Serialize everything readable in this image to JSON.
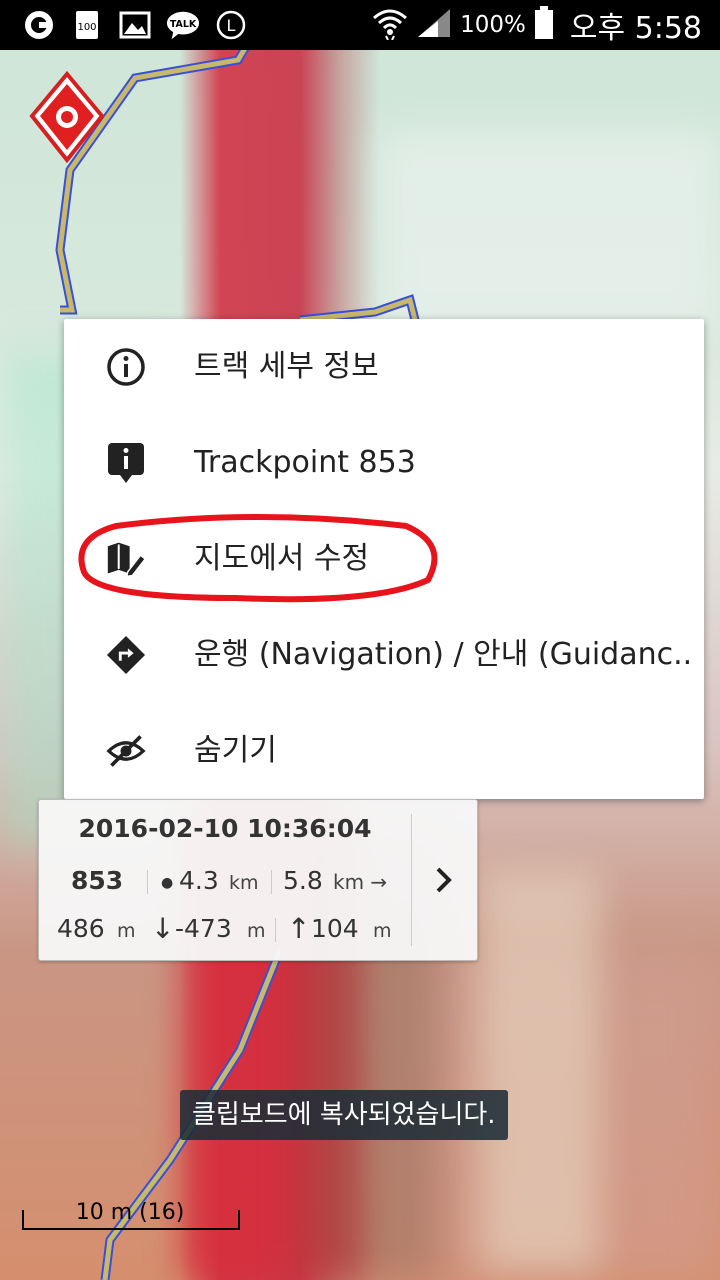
{
  "status_bar": {
    "icons": [
      "g-app-icon",
      "100-badge-icon",
      "image-icon",
      "talk-icon",
      "l-circle-icon"
    ],
    "talk_label": "TALK",
    "badge_label": "100",
    "l_label": "L",
    "battery": "100%",
    "time": "오후 5:58"
  },
  "menu": {
    "items": [
      {
        "icon": "info-circle-icon",
        "label": "트랙 세부 정보"
      },
      {
        "icon": "info-marker-icon",
        "label": "Trackpoint 853"
      },
      {
        "icon": "edit-map-icon",
        "label": "지도에서 수정"
      },
      {
        "icon": "navigation-diamond-icon",
        "label": "운행 (Navigation) / 안내 (Guidanc.."
      },
      {
        "icon": "hide-eye-icon",
        "label": "숨기기"
      }
    ]
  },
  "info_panel": {
    "datetime": "2016-02-10 10:36:04",
    "point": "853",
    "dist1_value": "4.3",
    "dist1_unit": "km",
    "dist2_value": "5.8",
    "dist2_unit": "km →",
    "alt_value": "486",
    "alt_unit": "m",
    "descent_value": "-473",
    "descent_unit": "m",
    "ascent_value": "104",
    "ascent_unit": "m"
  },
  "toast": "클립보드에 복사되었습니다.",
  "scale": "10 m (16)",
  "colors": {
    "highlight": "#e8141c",
    "track": "#c8b86a",
    "track_edge": "#3a4fd8"
  }
}
